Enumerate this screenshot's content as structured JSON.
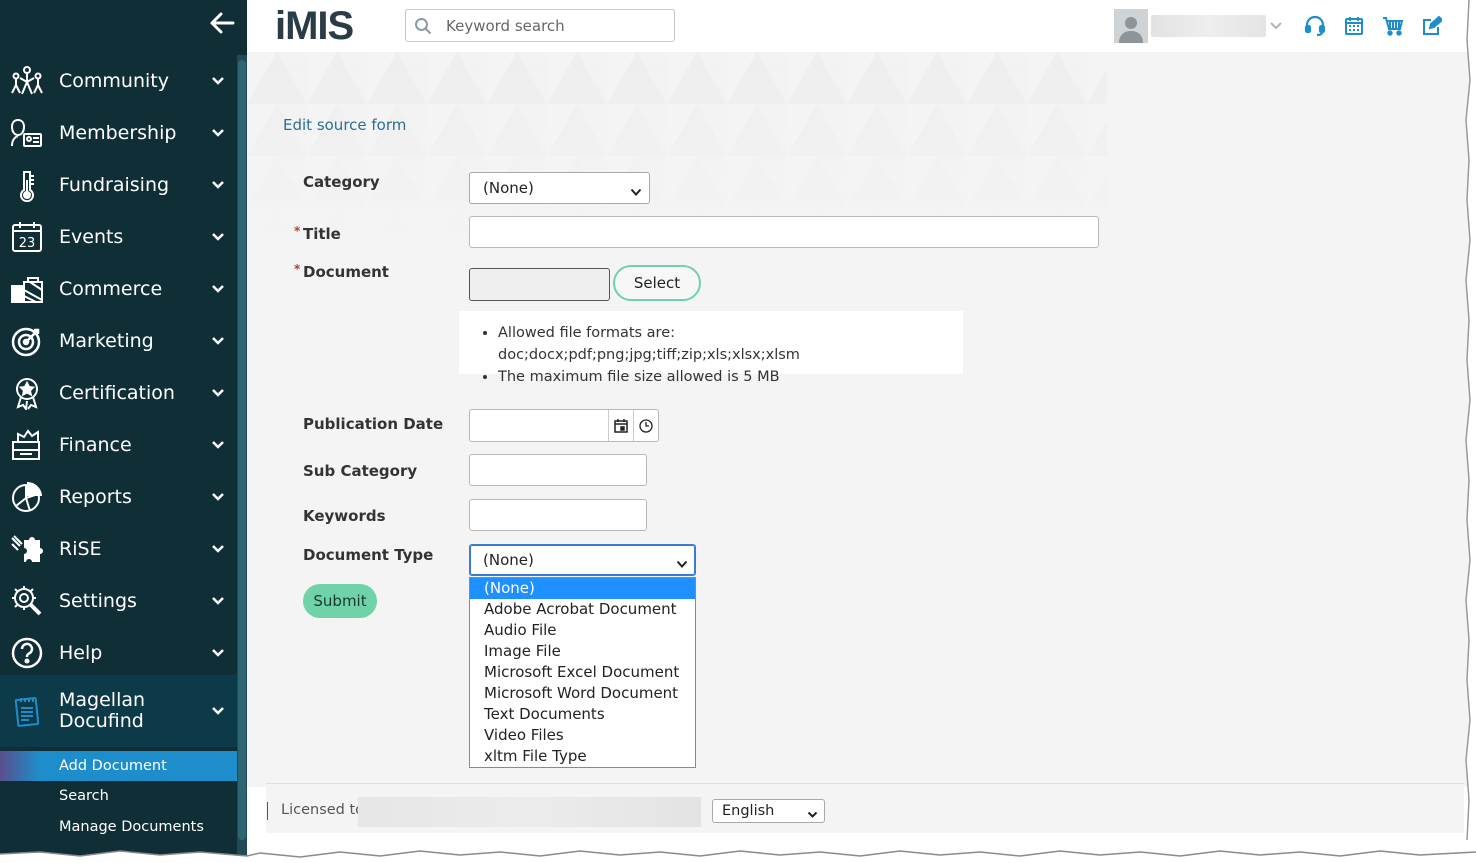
{
  "sidebar": {
    "back_icon": "arrow-left-icon",
    "items": [
      {
        "label": "Community",
        "icon": "community-icon"
      },
      {
        "label": "Membership",
        "icon": "membership-icon"
      },
      {
        "label": "Fundraising",
        "icon": "fundraising-icon"
      },
      {
        "label": "Events",
        "icon": "calendar-icon"
      },
      {
        "label": "Commerce",
        "icon": "commerce-icon"
      },
      {
        "label": "Marketing",
        "icon": "target-icon"
      },
      {
        "label": "Certification",
        "icon": "certification-icon"
      },
      {
        "label": "Finance",
        "icon": "finance-icon"
      },
      {
        "label": "Reports",
        "icon": "reports-icon"
      },
      {
        "label": "RiSE",
        "icon": "puzzle-icon"
      },
      {
        "label": "Settings",
        "icon": "settings-icon"
      },
      {
        "label": "Help",
        "icon": "help-icon"
      }
    ],
    "active_item": {
      "label_line1": "Magellan",
      "label_line2": "Docufind",
      "icon": "notepad-icon"
    },
    "sub_items": [
      {
        "label": "Add Document",
        "selected": true
      },
      {
        "label": "Search",
        "selected": false
      },
      {
        "label": "Manage Documents",
        "selected": false
      }
    ]
  },
  "header": {
    "logo": "iMIS",
    "search_placeholder": "Keyword search",
    "icons": [
      "support-icon",
      "calendar-icon",
      "cart-icon",
      "edit-icon"
    ]
  },
  "main": {
    "breadcrumb": "Edit source form",
    "form": {
      "category_label": "Category",
      "category_value": "(None)",
      "title_label": "Title",
      "document_label": "Document",
      "select_button": "Select",
      "info": [
        "Allowed file formats are: doc;docx;pdf;png;jpg;tiff;zip;xls;xlsx;xlsm",
        "The maximum file size allowed is 5 MB"
      ],
      "publication_date_label": "Publication Date",
      "sub_category_label": "Sub Category",
      "keywords_label": "Keywords",
      "document_type_label": "Document Type",
      "document_type_value": "(None)",
      "document_type_options": [
        "(None)",
        "Adobe Acrobat Document",
        "Audio File",
        "Image File",
        "Microsoft Excel Document",
        "Microsoft Word Document",
        "Text Documents",
        "Video Files",
        "xltm File Type"
      ],
      "submit_button": "Submit",
      "required_marker": "*"
    }
  },
  "footer": {
    "licensed_text": "Licensed to",
    "language": "English"
  },
  "colors": {
    "sidebar_bg": "#0f2e36",
    "accent_green": "#6fd2a8",
    "selected_blue": "#1d8ecb",
    "link_blue": "#2a6e96"
  }
}
